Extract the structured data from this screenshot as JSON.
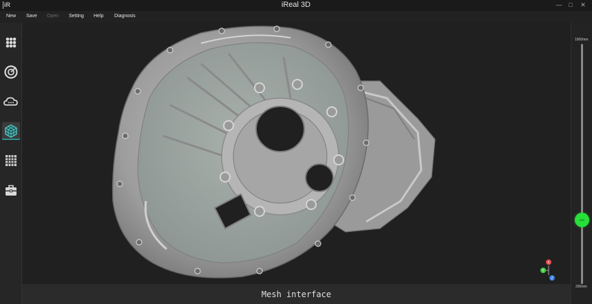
{
  "window": {
    "title": "iReal 3D",
    "logo_text": "iR",
    "controls": {
      "minimize": "—",
      "maximize": "□",
      "close": "✕"
    }
  },
  "menu": {
    "items": [
      {
        "label": "New",
        "enabled": true
      },
      {
        "label": "Save",
        "enabled": true
      },
      {
        "label": "Open",
        "enabled": false
      },
      {
        "label": "Setting",
        "enabled": true
      },
      {
        "label": "Help",
        "enabled": true
      },
      {
        "label": "Diagnosis",
        "enabled": true
      }
    ]
  },
  "sidebar": {
    "items": [
      {
        "icon": "grid-dots-icon",
        "active": false
      },
      {
        "icon": "scan-target-icon",
        "active": false
      },
      {
        "icon": "cloud-icon",
        "active": false
      },
      {
        "icon": "mesh-cube-icon",
        "active": true
      },
      {
        "icon": "grid-panel-icon",
        "active": false
      },
      {
        "icon": "toolbox-icon",
        "active": false
      }
    ]
  },
  "status": {
    "text": "Mesh interface"
  },
  "depth_slider": {
    "max_label": "1000mm",
    "min_label": "200mm",
    "thumb_label": "400",
    "value_mm": 400
  },
  "axis_gizmo": {
    "x": "X",
    "y": "Y",
    "z": "Z"
  },
  "colors": {
    "accent": "#2f8f8f",
    "slider_thumb": "#27e03a",
    "axis_x": "#e04848",
    "axis_y": "#3fcf3f",
    "axis_z": "#3a7fe0"
  }
}
